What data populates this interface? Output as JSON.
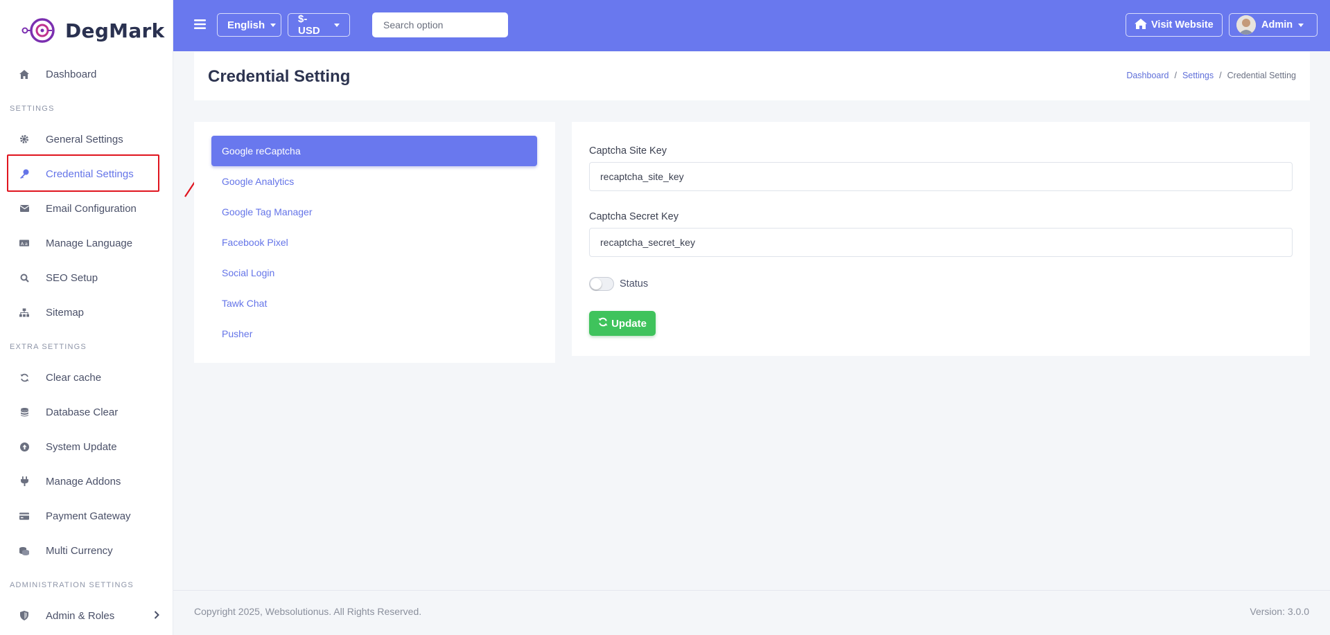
{
  "brand": {
    "name": "DegMark"
  },
  "sidebar": {
    "dashboard": "Dashboard",
    "section_settings": "SETTINGS",
    "items_settings": [
      "General Settings",
      "Credential Settings",
      "Email Configuration",
      "Manage Language",
      "SEO Setup",
      "Sitemap"
    ],
    "section_extra": "EXTRA SETTINGS",
    "items_extra": [
      "Clear cache",
      "Database Clear",
      "System Update",
      "Manage Addons",
      "Payment Gateway",
      "Multi Currency"
    ],
    "section_admin": "ADMINISTRATION SETTINGS",
    "items_admin": [
      "Admin & Roles"
    ]
  },
  "topbar": {
    "language": "English",
    "currency": "$-USD",
    "search_placeholder": "Search option",
    "visit_website": "Visit Website",
    "user": "Admin"
  },
  "header": {
    "title": "Credential Setting",
    "breadcrumb": [
      "Dashboard",
      "Settings",
      "Credential Setting"
    ]
  },
  "tabs": [
    "Google reCaptcha",
    "Google Analytics",
    "Google Tag Manager",
    "Facebook Pixel",
    "Social Login",
    "Tawk Chat",
    "Pusher"
  ],
  "form": {
    "site_key_label": "Captcha Site Key",
    "site_key_value": "recaptcha_site_key",
    "secret_key_label": "Captcha Secret Key",
    "secret_key_value": "recaptcha_secret_key",
    "status_label": "Status",
    "update_label": "Update"
  },
  "footer": {
    "copyright": "Copyright 2025, Websolutionus. All Rights Reserved.",
    "version": "Version: 3.0.0"
  },
  "colors": {
    "primary": "#6978ee",
    "success": "#3fc35c",
    "highlight": "#e0141e"
  }
}
